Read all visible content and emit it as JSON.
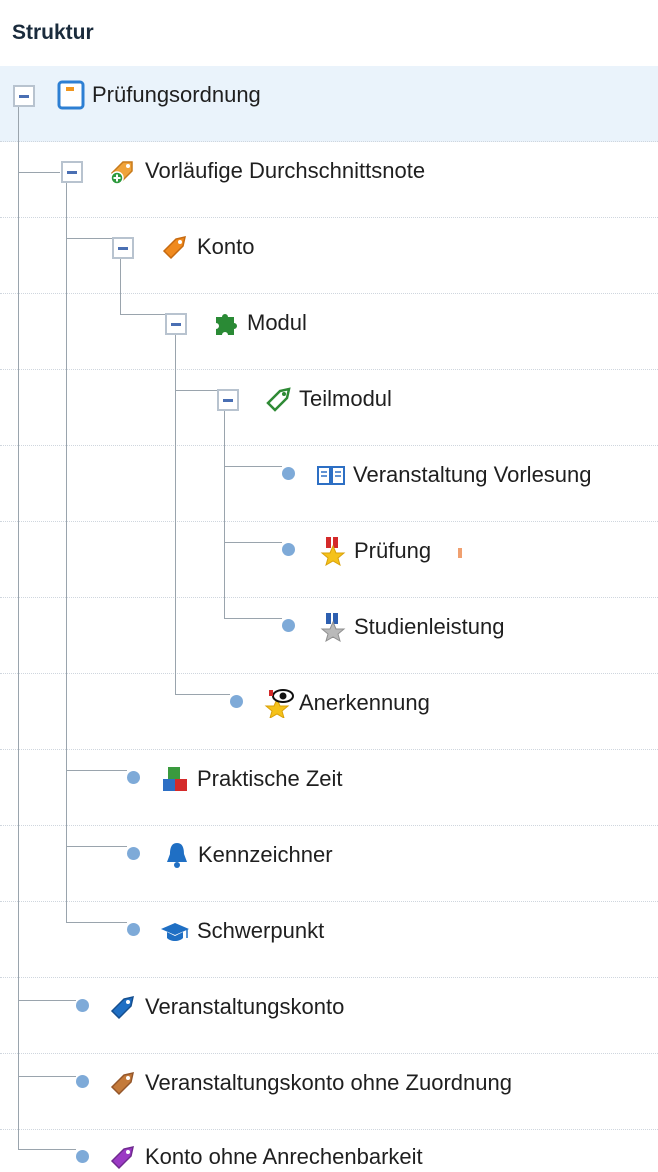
{
  "panel": {
    "title": "Struktur"
  },
  "tree": {
    "items": [
      {
        "label": "Prüfungsordnung",
        "icon": "document-icon"
      },
      {
        "label": "Vorläufige Durchschnittsnote",
        "icon": "tag-plus-icon"
      },
      {
        "label": "Konto",
        "icon": "tag-icon"
      },
      {
        "label": "Modul",
        "icon": "puzzle-icon"
      },
      {
        "label": "Teilmodul",
        "icon": "tag-green-icon"
      },
      {
        "label": "Veranstaltung Vorlesung",
        "icon": "book-icon"
      },
      {
        "label": "Prüfung",
        "icon": "medal-star-icon"
      },
      {
        "label": "Studienleistung",
        "icon": "medal-grey-icon"
      },
      {
        "label": "Anerkennung",
        "icon": "eye-star-icon"
      },
      {
        "label": "Praktische Zeit",
        "icon": "blocks-icon"
      },
      {
        "label": "Kennzeichner",
        "icon": "bell-icon"
      },
      {
        "label": "Schwerpunkt",
        "icon": "graduation-cap-icon"
      },
      {
        "label": "Veranstaltungskonto",
        "icon": "tag-blue-icon"
      },
      {
        "label": "Veranstaltungskonto ohne Zuordnung",
        "icon": "tag-brown-icon"
      },
      {
        "label": "Konto ohne Anrechenbarkeit",
        "icon": "tag-purple-icon"
      }
    ]
  },
  "colors": {
    "selected_row": "#eaf3fb",
    "connector": "#9aa4ad",
    "bullet": "#7eaad8",
    "toggle_mark": "#4a6fb3"
  }
}
